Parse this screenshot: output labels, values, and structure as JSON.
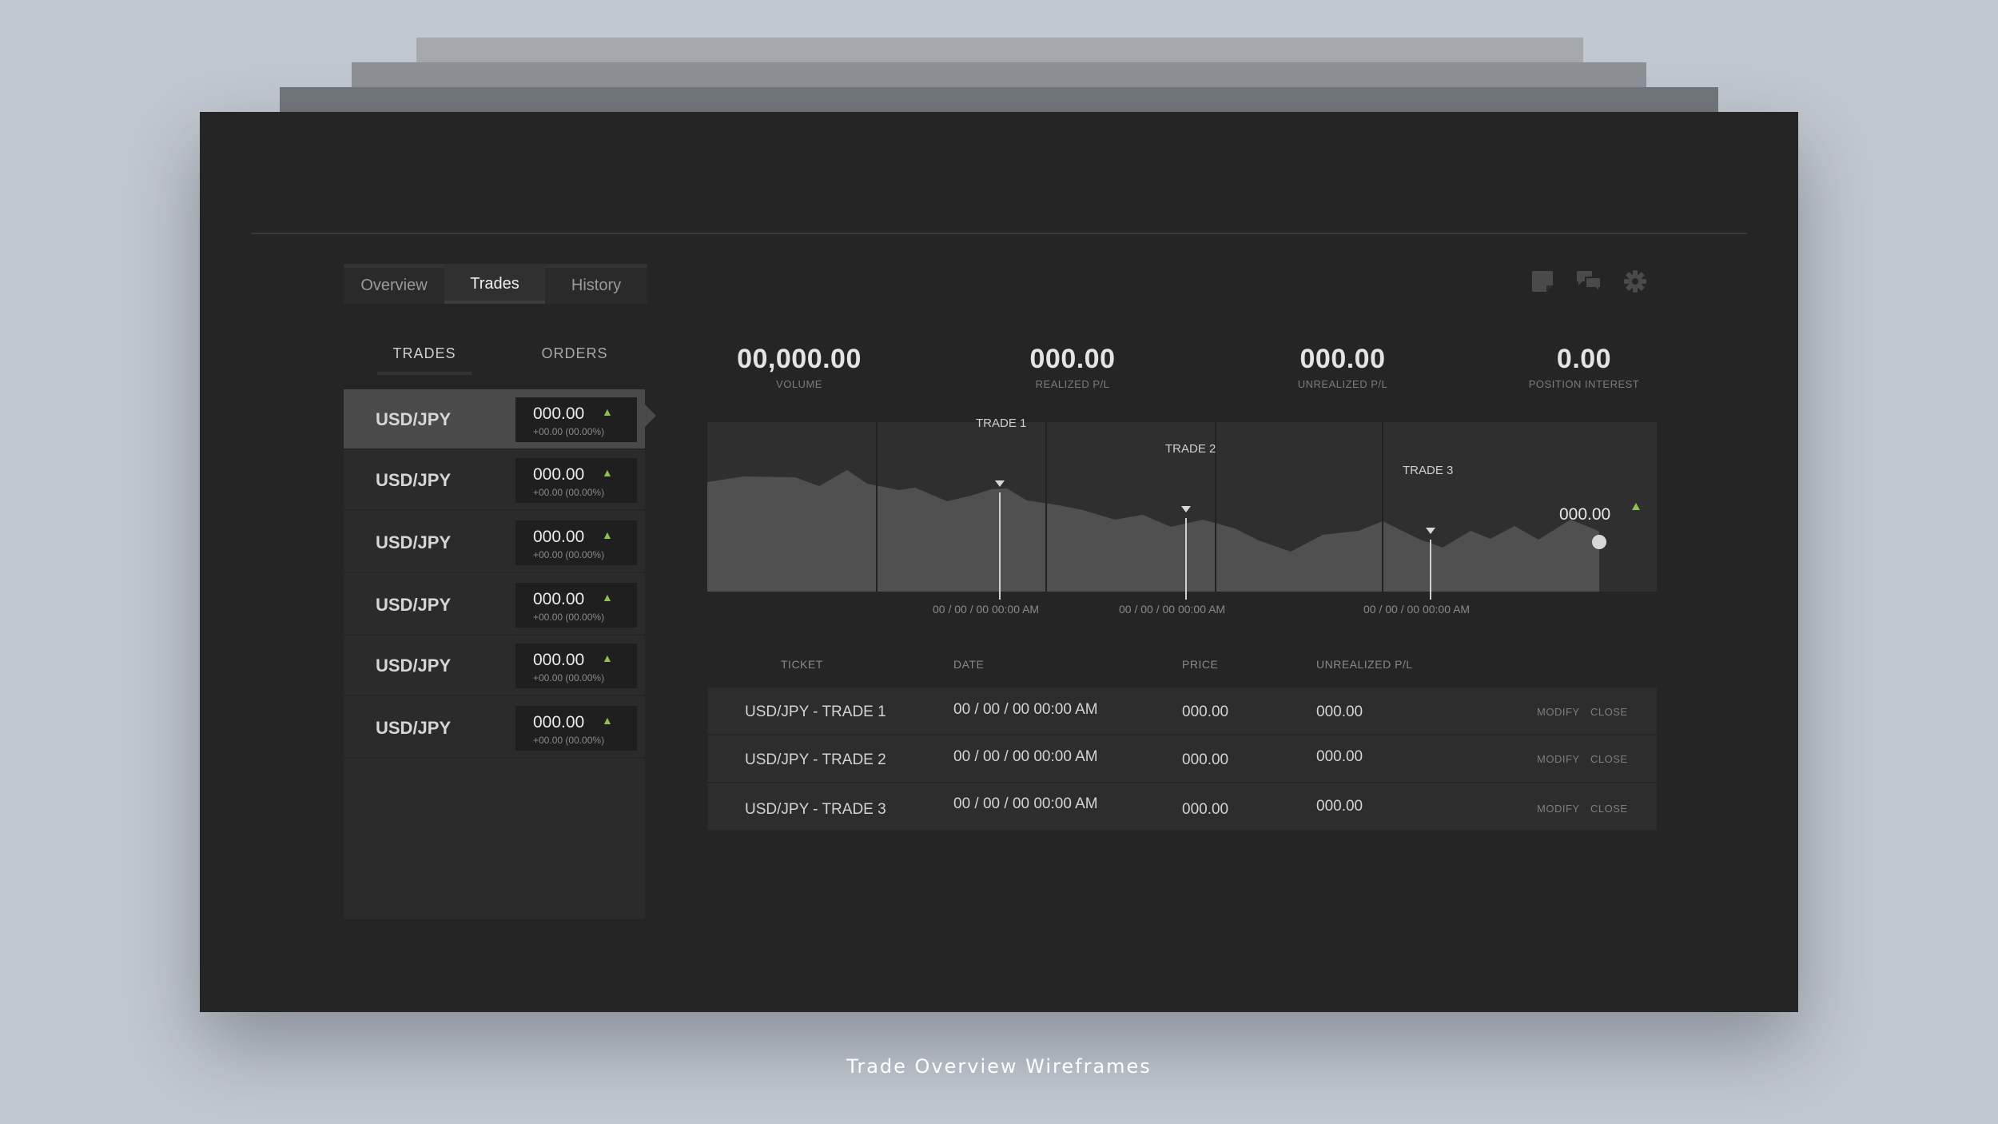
{
  "tabs": [
    "Overview",
    "Trades",
    "History"
  ],
  "subtabs": [
    "TRADES",
    "ORDERS"
  ],
  "icons": [
    "note-icon",
    "chat-icon",
    "gear-icon"
  ],
  "colors": {
    "accent_up": "#8bc34a",
    "window_bg": "#252525",
    "page_bg": "#c2c8d1"
  },
  "instruments": [
    {
      "pair": "USD/JPY",
      "price": "000.00",
      "change": "+00.00 (00.00%)"
    },
    {
      "pair": "USD/JPY",
      "price": "000.00",
      "change": "+00.00 (00.00%)"
    },
    {
      "pair": "USD/JPY",
      "price": "000.00",
      "change": "+00.00 (00.00%)"
    },
    {
      "pair": "USD/JPY",
      "price": "000.00",
      "change": "+00.00 (00.00%)"
    },
    {
      "pair": "USD/JPY",
      "price": "000.00",
      "change": "+00.00 (00.00%)"
    },
    {
      "pair": "USD/JPY",
      "price": "000.00",
      "change": "+00.00 (00.00%)"
    }
  ],
  "stats": {
    "volume": {
      "value": "00,000.00",
      "label": "VOLUME"
    },
    "realized": {
      "value": "000.00",
      "label": "REALIZED P/L"
    },
    "unrealized": {
      "value": "000.00",
      "label": "UNREALIZED P/L"
    },
    "interest": {
      "value": "0.00",
      "label": "POSITION INTEREST"
    }
  },
  "chart": {
    "markers": [
      "TRADE 1",
      "TRADE 2",
      "TRADE 3"
    ],
    "current_value": "000.00",
    "dates": [
      "00 / 00 / 00 00:00 AM",
      "00 / 00 / 00 00:00 AM",
      "00 / 00 / 00 00:00 AM"
    ]
  },
  "table": {
    "headers": [
      "TICKET",
      "DATE",
      "PRICE",
      "UNREALIZED P/L"
    ],
    "rows": [
      {
        "ticket": "USD/JPY - TRADE 1",
        "date": "00 / 00 / 00 00:00 AM",
        "price": "000.00",
        "pl": "000.00",
        "modify": "MODIFY",
        "close": "CLOSE"
      },
      {
        "ticket": "USD/JPY - TRADE 2",
        "date": "00 / 00 / 00 00:00 AM",
        "price": "000.00",
        "pl": "000.00",
        "modify": "MODIFY",
        "close": "CLOSE"
      },
      {
        "ticket": "USD/JPY - TRADE 3",
        "date": "00 / 00 / 00 00:00 AM",
        "price": "000.00",
        "pl": "000.00",
        "modify": "MODIFY",
        "close": "CLOSE"
      }
    ]
  },
  "caption": "Trade Overview Wireframes"
}
